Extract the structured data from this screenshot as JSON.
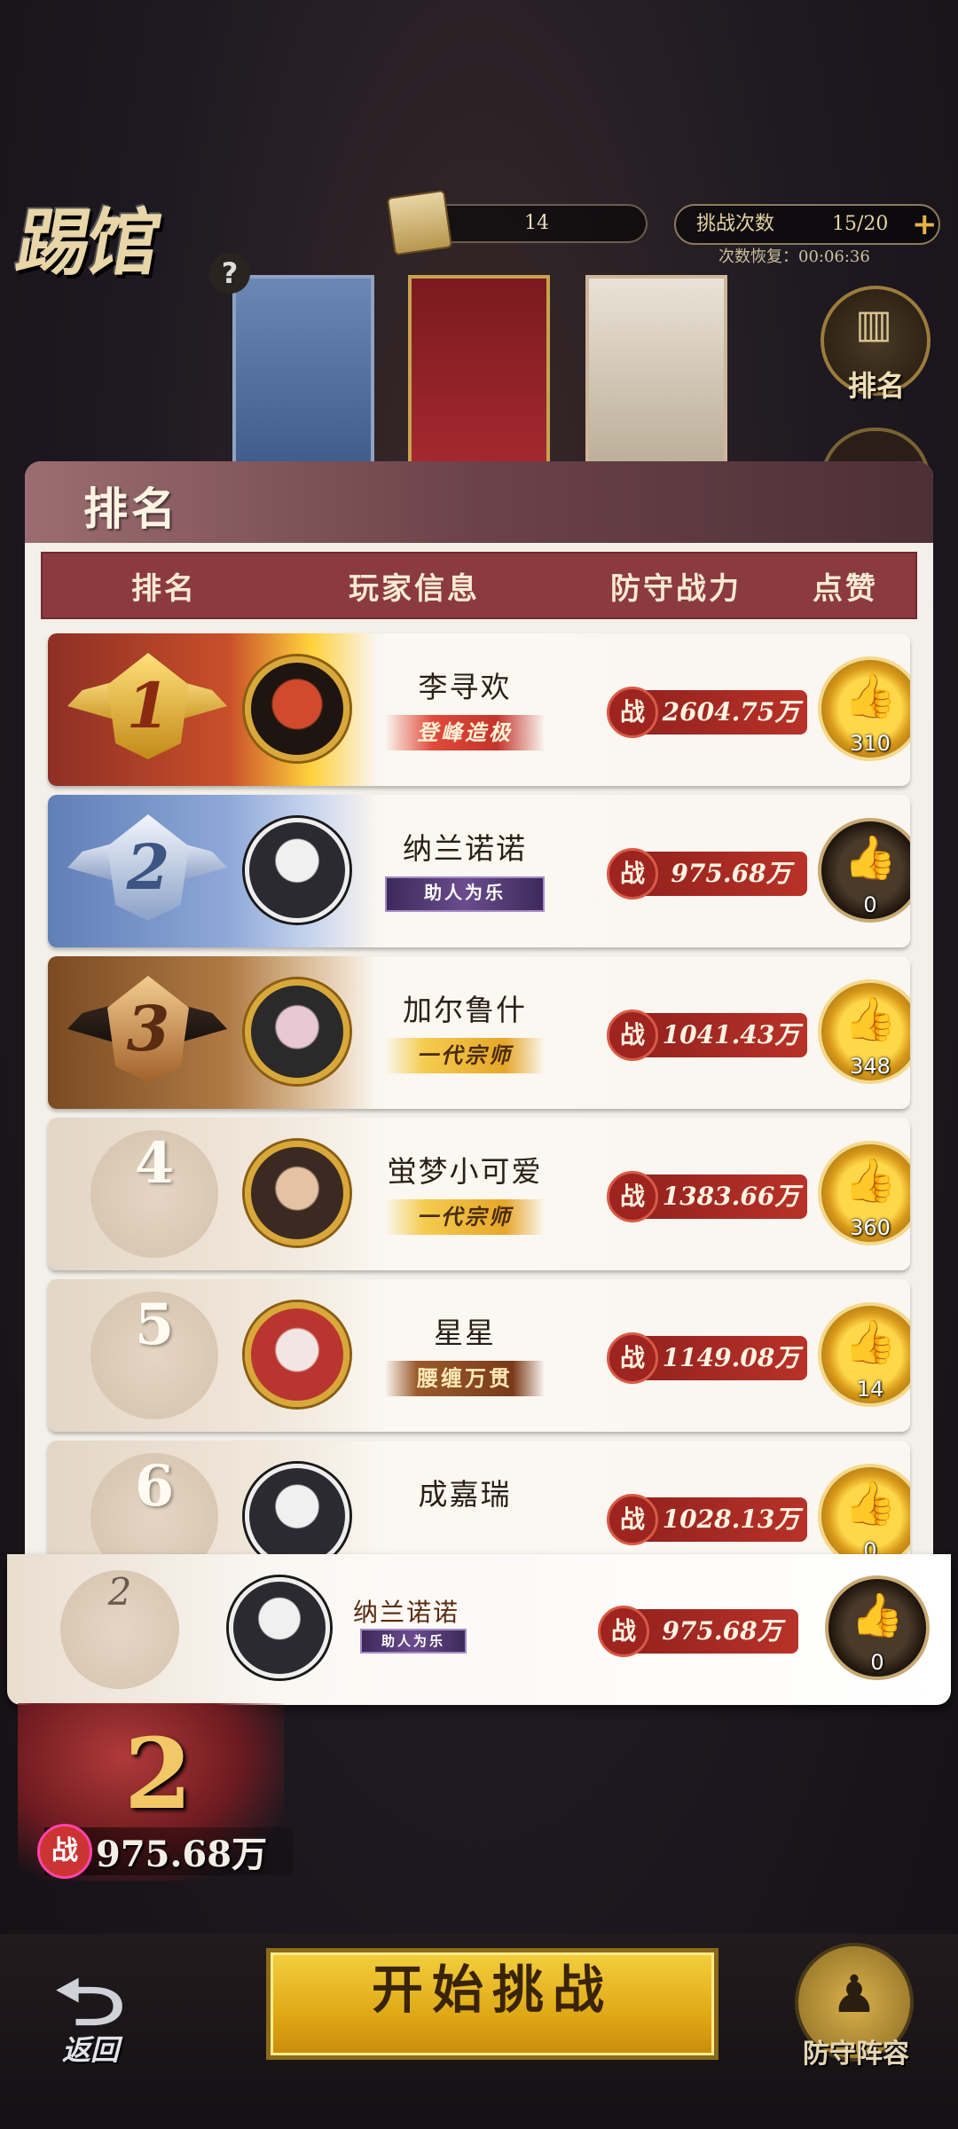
{
  "hud": {
    "logo_text": "踢馆",
    "help": "?",
    "token_value": "14",
    "challenge_label": "挑战次数",
    "challenge_value": "15/20",
    "recover_text": "次数恢复：00:06:36",
    "rank_button_label": "排名"
  },
  "panel": {
    "title": "排名",
    "columns": [
      "排名",
      "玩家信息",
      "防守战力",
      "点赞"
    ]
  },
  "rows": [
    {
      "rank": "1",
      "name": "李寻欢",
      "title": "登峰造极",
      "power_tag": "战",
      "power": "2604.75万",
      "likes": "310"
    },
    {
      "rank": "2",
      "name": "纳兰诺诺",
      "title": "助人为乐",
      "power_tag": "战",
      "power": "975.68万",
      "likes": "0"
    },
    {
      "rank": "3",
      "name": "加尔鲁什",
      "title": "一代宗师",
      "power_tag": "战",
      "power": "1041.43万",
      "likes": "348"
    },
    {
      "rank": "4",
      "name": "蛍梦小可爱",
      "title": "一代宗师",
      "power_tag": "战",
      "power": "1383.66万",
      "likes": "360"
    },
    {
      "rank": "5",
      "name": "星星",
      "title": "腰缠万贯",
      "power_tag": "战",
      "power": "1149.08万",
      "likes": "14"
    },
    {
      "rank": "6",
      "name": "成嘉瑞",
      "title": "",
      "power_tag": "战",
      "power": "1028.13万",
      "likes": "0"
    }
  ],
  "my_rank": {
    "rank": "2",
    "name": "纳兰诺诺",
    "title": "助人为乐",
    "power_tag": "战",
    "power": "975.68万",
    "likes": "0"
  },
  "arena": {
    "big_rank": "2",
    "power_icon": "战",
    "power": "975.68万"
  },
  "bottom": {
    "back_label": "返回",
    "start_label": "开始挑战",
    "defense_label": "防守阵容"
  },
  "icons": {
    "help": "question-icon",
    "token": "scroll-icon",
    "plus": "plus-icon",
    "rank": "bar-chart-icon",
    "like": "thumbs-up-icon",
    "back": "back-arrow-icon",
    "defense": "person-icon"
  }
}
